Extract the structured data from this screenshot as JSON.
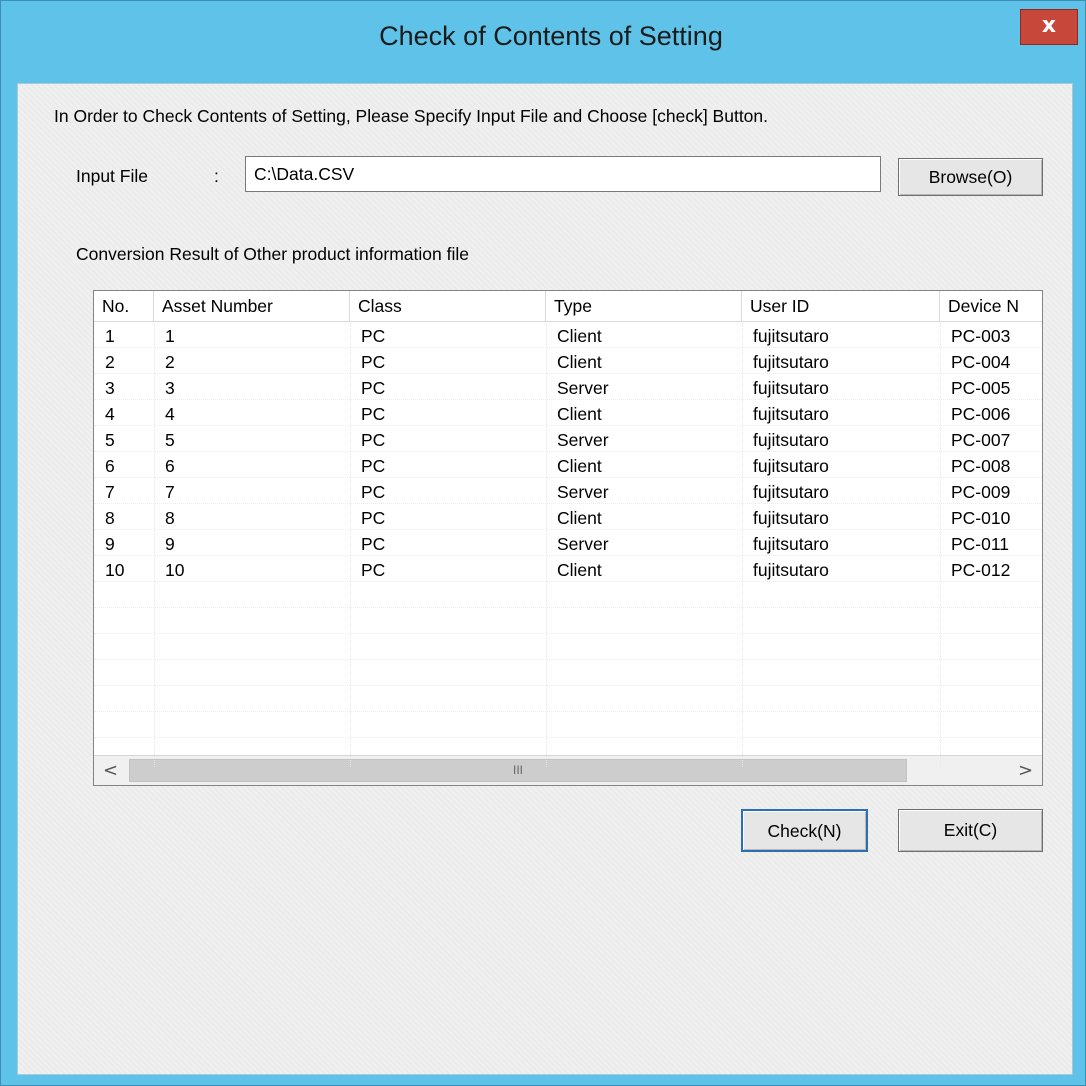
{
  "window": {
    "title": "Check of Contents of Setting",
    "close_glyph": "x"
  },
  "instruction": "In Order to Check Contents of Setting, Please Specify Input File and Choose [check] Button.",
  "input": {
    "label": "Input File",
    "colon": ":",
    "value": "C:\\Data.CSV",
    "browse_label": "Browse(O)"
  },
  "result_label": "Conversion Result of Other product information file",
  "table": {
    "columns": [
      "No.",
      "Asset Number",
      "Class",
      "Type",
      "User ID",
      "Device N"
    ],
    "rows": [
      [
        "1",
        "1",
        "PC",
        "Client",
        "fujitsutaro",
        "PC-003"
      ],
      [
        "2",
        "2",
        "PC",
        "Client",
        "fujitsutaro",
        "PC-004"
      ],
      [
        "3",
        "3",
        "PC",
        "Server",
        "fujitsutaro",
        "PC-005"
      ],
      [
        "4",
        "4",
        "PC",
        "Client",
        "fujitsutaro",
        "PC-006"
      ],
      [
        "5",
        "5",
        "PC",
        "Server",
        "fujitsutaro",
        "PC-007"
      ],
      [
        "6",
        "6",
        "PC",
        "Client",
        "fujitsutaro",
        "PC-008"
      ],
      [
        "7",
        "7",
        "PC",
        "Server",
        "fujitsutaro",
        "PC-009"
      ],
      [
        "8",
        "8",
        "PC",
        "Client",
        "fujitsutaro",
        "PC-010"
      ],
      [
        "9",
        "9",
        "PC",
        "Server",
        "fujitsutaro",
        "PC-011"
      ],
      [
        "10",
        "10",
        "PC",
        "Client",
        "fujitsutaro",
        "PC-012"
      ]
    ],
    "scroll_left_glyph": "<",
    "scroll_right_glyph": ">",
    "thumb_grip": "III"
  },
  "buttons": {
    "check_label": "Check(N)",
    "exit_label": "Exit(C)"
  }
}
